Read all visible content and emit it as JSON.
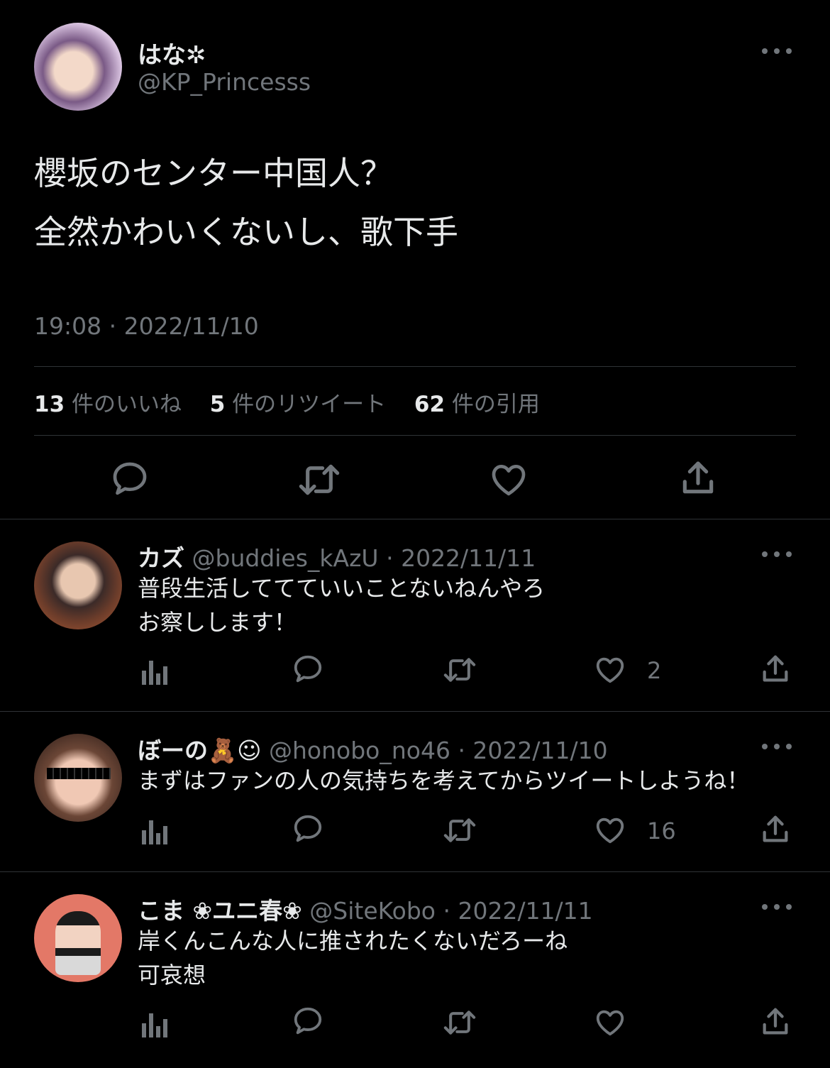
{
  "main_tweet": {
    "display_name": "はな✲",
    "handle": "@KP_Princesss",
    "text_line1": "櫻坂のセンター中国人？",
    "text_line2": "全然かわいくないし、歌下手",
    "timestamp": "19:08 · 2022/11/10",
    "stats": {
      "likes_count": "13",
      "likes_label": "件のいいね",
      "retweets_count": "5",
      "retweets_label": "件のリツイート",
      "quotes_count": "62",
      "quotes_label": "件の引用"
    }
  },
  "replies": [
    {
      "display_name": "カズ",
      "handle": "@buddies_kAzU",
      "date": "· 2022/11/11",
      "text": "普段生活しててていいことないねんやろ\nお察しします！",
      "like_count": "2"
    },
    {
      "display_name": "ぼーの🧸☺",
      "handle": "@honobo_no46",
      "date": "· 2022/11/10",
      "text": "まずはファンの人の気持ちを考えてからツイートしようね！",
      "like_count": "16"
    },
    {
      "display_name": "こま ❀ユニ春❀",
      "handle": "@SiteKobo",
      "date": "· 2022/11/11",
      "text": "岸くんこんな人に推されたくないだろーね\n可哀想",
      "like_count": ""
    }
  ],
  "colors": {
    "background": "#000000",
    "text": "#e7e9ea",
    "secondary": "#71767b",
    "divider": "#2f3336"
  },
  "icons": [
    "more-icon",
    "reply-icon",
    "retweet-icon",
    "like-icon",
    "share-icon",
    "analytics-icon"
  ]
}
